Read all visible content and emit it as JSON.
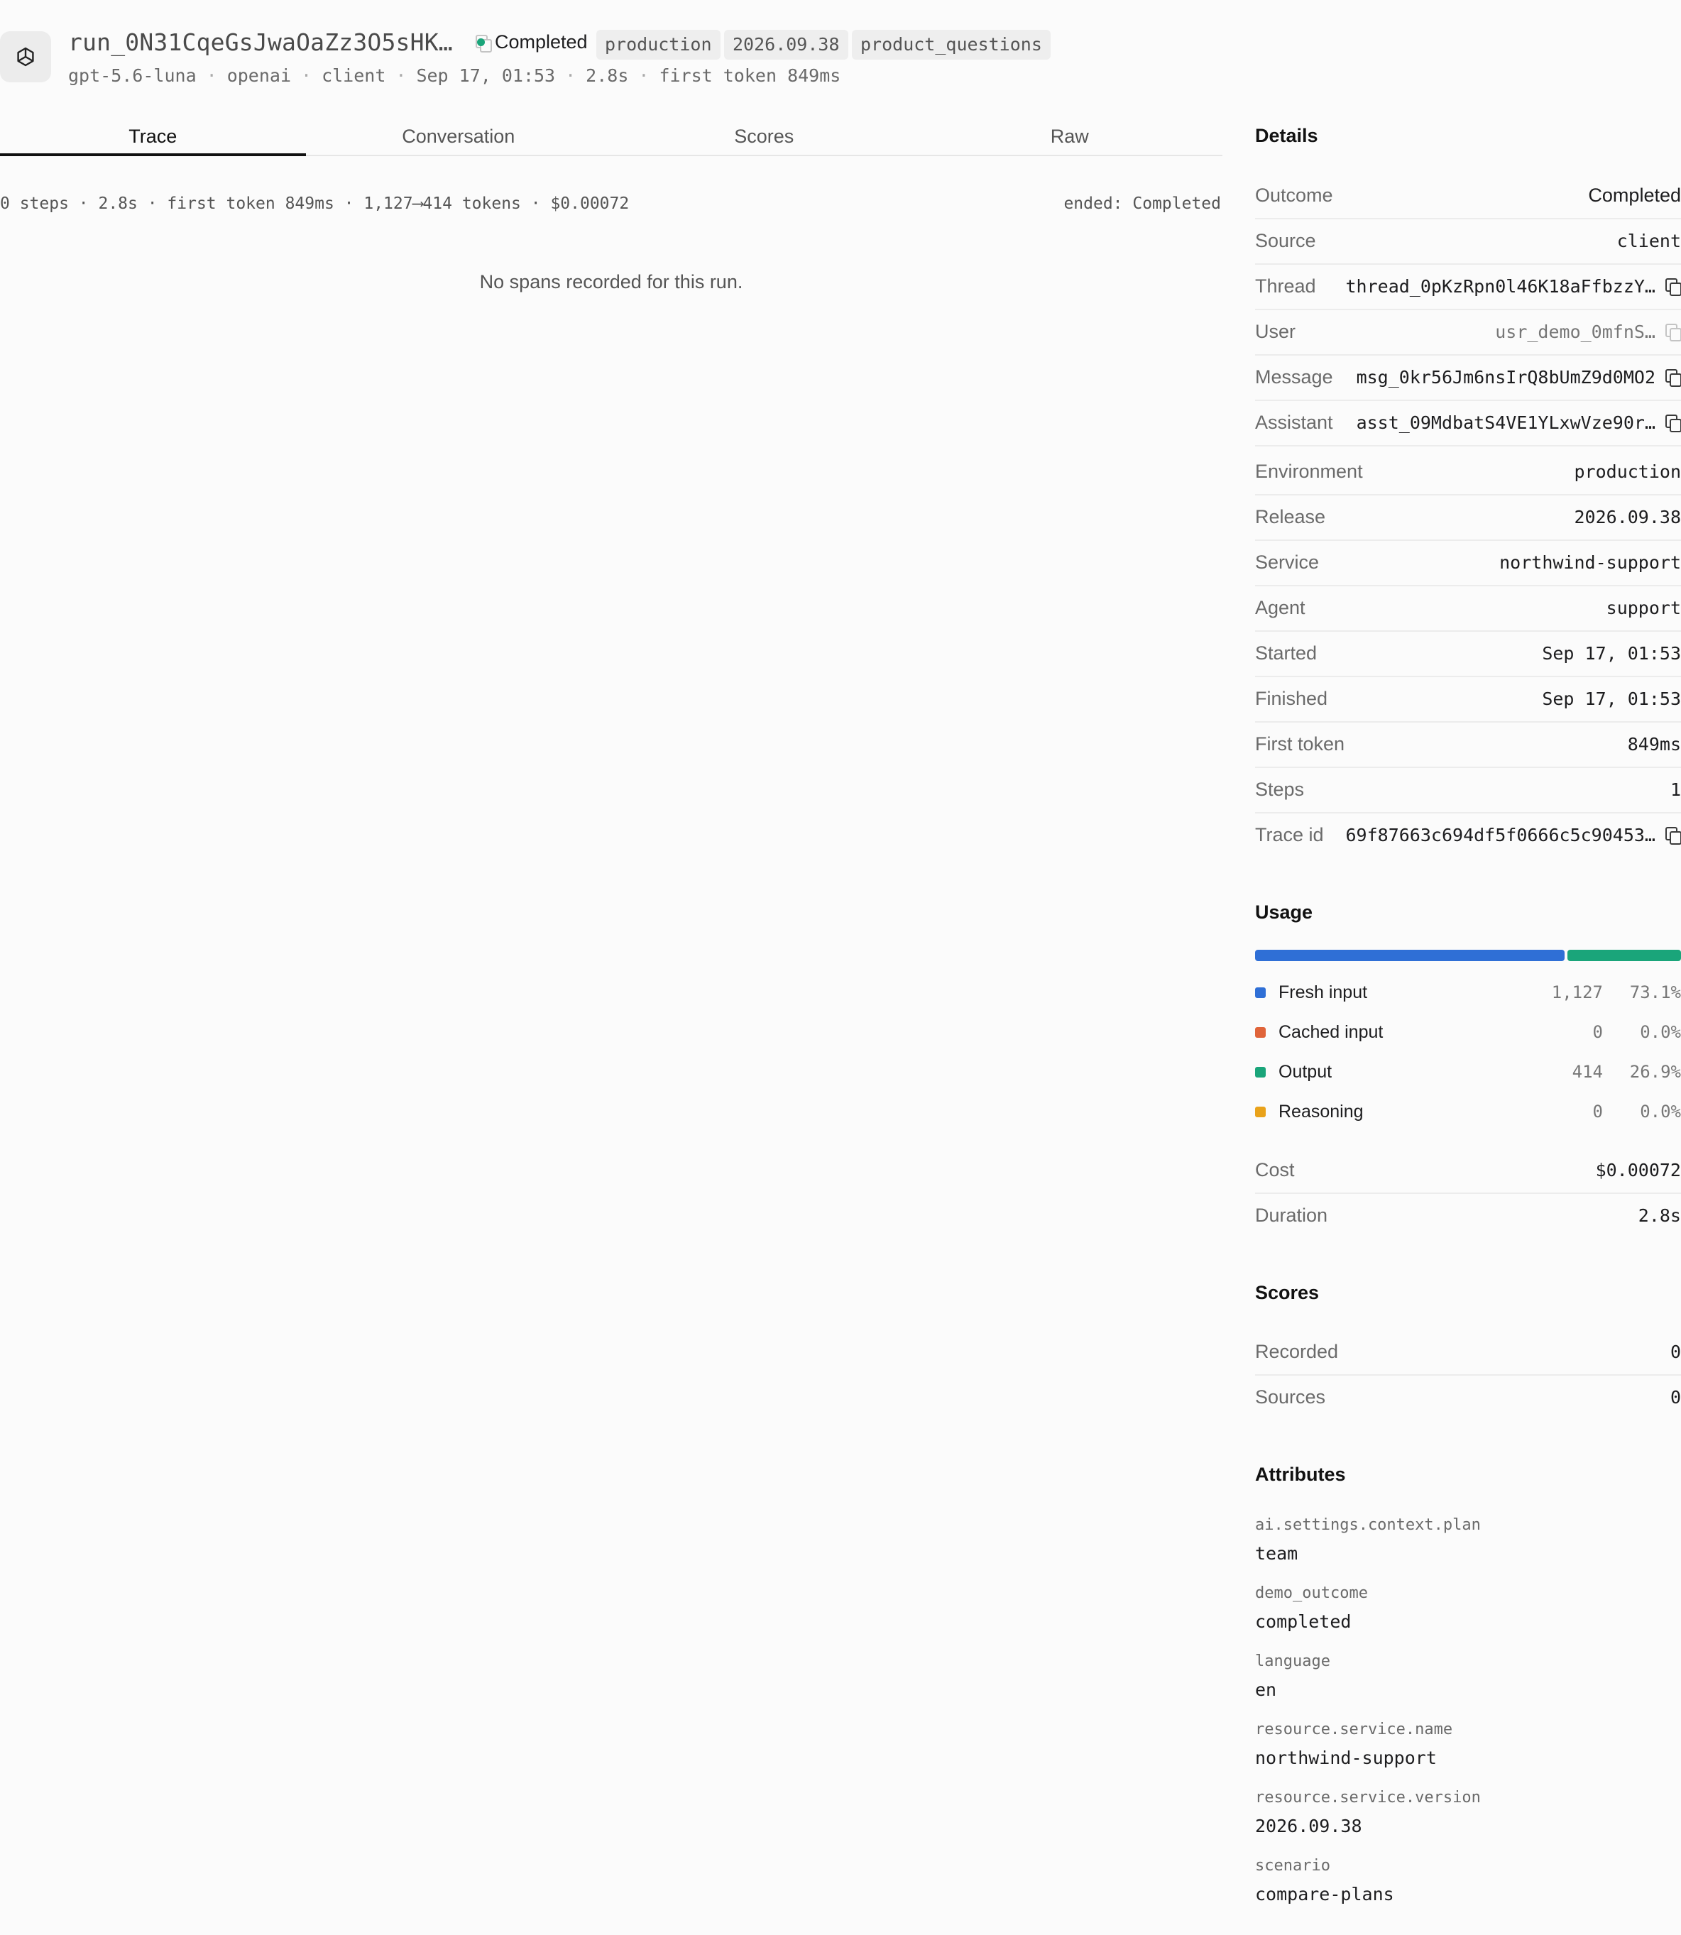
{
  "header": {
    "icon": "openai-logo-icon",
    "run_id": "run_0N31CqeGsJwaOaZz3O5sHK…",
    "status": "Completed",
    "status_color": "#1aa57a",
    "tags": [
      "production",
      "2026.09.38",
      "product_questions"
    ],
    "meta": [
      "gpt-5.6-luna",
      "openai",
      "client",
      "Sep 17, 01:53",
      "2.8s",
      "first token 849ms"
    ]
  },
  "tabs": [
    "Trace",
    "Conversation",
    "Scores",
    "Raw"
  ],
  "active_tab": "Trace",
  "trace": {
    "stats": "0 steps · 2.8s · first token 849ms · 1,127⟶414 tokens · $0.00072",
    "ended": "ended: Completed",
    "empty_message": "No spans recorded for this run."
  },
  "details": {
    "title": "Details",
    "rows": [
      {
        "label": "Outcome",
        "value": "Completed"
      },
      {
        "label": "Source",
        "value": "client"
      },
      {
        "label": "Thread",
        "value": "thread_0pKzRpn0l46K18aFfbzzY…"
      },
      {
        "label": "User",
        "value": "usr_demo_0mfnS…"
      },
      {
        "label": "Message",
        "value": "msg_0kr56Jm6nsIrQ8bUmZ9d0MO2"
      },
      {
        "label": "Assistant",
        "value": "asst_09MdbatS4VE1YLxwVze90r…"
      },
      {
        "label": "Environment",
        "value": "production"
      },
      {
        "label": "Release",
        "value": "2026.09.38"
      },
      {
        "label": "Service",
        "value": "northwind-support"
      },
      {
        "label": "Agent",
        "value": "support"
      },
      {
        "label": "Started",
        "value": "Sep 17, 01:53"
      },
      {
        "label": "Finished",
        "value": "Sep 17, 01:53"
      },
      {
        "label": "First token",
        "value": "849ms"
      },
      {
        "label": "Steps",
        "value": "1"
      },
      {
        "label": "Trace id",
        "value": "69f87663c694df5f0666c5c90453…"
      }
    ]
  },
  "usage": {
    "title": "Usage",
    "items": [
      {
        "label": "Fresh input",
        "count": "1,127",
        "pct": "73.1%",
        "fraction": 0.731,
        "color": "#2f6fd6"
      },
      {
        "label": "Cached input",
        "count": "0",
        "pct": "0.0%",
        "fraction": 0.0,
        "color": "#e0643a"
      },
      {
        "label": "Output",
        "count": "414",
        "pct": "26.9%",
        "fraction": 0.269,
        "color": "#1aa57a"
      },
      {
        "label": "Reasoning",
        "count": "0",
        "pct": "0.0%",
        "fraction": 0.0,
        "color": "#e9a21a"
      }
    ],
    "rows": [
      {
        "label": "Cost",
        "value": "$0.00072"
      },
      {
        "label": "Duration",
        "value": "2.8s"
      }
    ]
  },
  "scores": {
    "title": "Scores",
    "rows": [
      {
        "label": "Recorded",
        "value": "0"
      },
      {
        "label": "Sources",
        "value": "0"
      }
    ]
  },
  "attributes": {
    "title": "Attributes",
    "items": [
      {
        "key": "ai.settings.context.plan",
        "value": "team"
      },
      {
        "key": "demo_outcome",
        "value": "completed"
      },
      {
        "key": "language",
        "value": "en"
      },
      {
        "key": "resource.service.name",
        "value": "northwind-support"
      },
      {
        "key": "resource.service.version",
        "value": "2026.09.38"
      },
      {
        "key": "scenario",
        "value": "compare-plans"
      }
    ]
  }
}
